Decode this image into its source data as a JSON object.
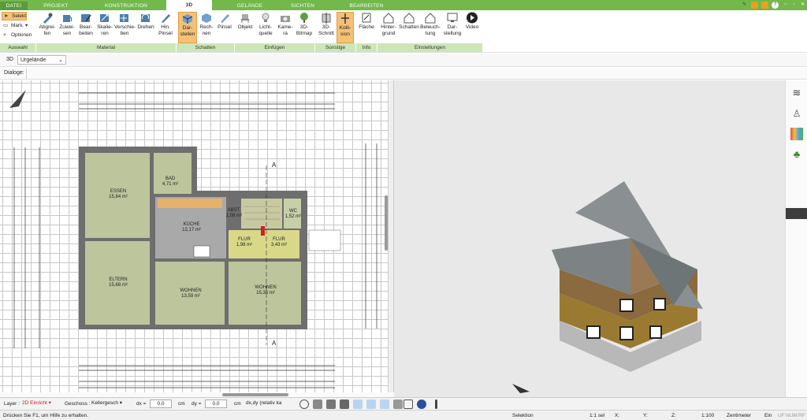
{
  "tabs": [
    "DATEI",
    "PROJEKT",
    "KONSTRUKTION",
    "3D",
    "GELÄNDE",
    "SICHTEN",
    "BEARBEITEN"
  ],
  "auswahl": {
    "select": "Selekt",
    "mark": "Mark.",
    "options": "Optionen",
    "group": "Auswahl"
  },
  "material": {
    "items": [
      "Abgrei-\nfen",
      "Zuwei-\nsen",
      "Bear-\nbeiten",
      "Skalie-\nren",
      "Verschie-\nben",
      "Drehen",
      "Hin.\nPinsel"
    ],
    "group": "Material"
  },
  "schatten": {
    "items": [
      "Dar-\nstellen",
      "Rech-\nnen",
      "Pinsel"
    ],
    "group": "Schatten"
  },
  "einfuegen": {
    "items": [
      "Objekt",
      "Licht-\nquelle",
      "Kame-\nra",
      "3D-\nBitmap"
    ],
    "group": "Einfügen"
  },
  "sonstige": {
    "items": [
      "3D-\nSchnitt",
      "Kolli-\nsion"
    ],
    "group": "Sonstige"
  },
  "info": {
    "items": [
      "Fläche"
    ],
    "group": "Info"
  },
  "einstellungen": {
    "items": [
      "Hinter-\ngrund",
      "Schatten",
      "Beleuch-\ntung",
      "Dar-\nstellung",
      "Video"
    ],
    "group": "Einstellungen"
  },
  "viewbar": {
    "mode": "3D",
    "terrain": "Urgelände"
  },
  "dialog_label": "Dialoge:",
  "rooms": [
    {
      "name": "ESSEN",
      "area": "15,84 m²"
    },
    {
      "name": "BAD",
      "area": "4,71 m²"
    },
    {
      "name": "KÜCHE",
      "area": "12,17 m²"
    },
    {
      "name": "ABST.",
      "area": "1,08 m²"
    },
    {
      "name": "WC",
      "area": "1,52 m²"
    },
    {
      "name": "FLUR",
      "area": "1,98 m²"
    },
    {
      "name": "FLUR",
      "area": "3,43 m²"
    },
    {
      "name": "ELTERN",
      "area": "15,68 m²"
    },
    {
      "name": "WOHNEN",
      "area": "13,59 m²"
    },
    {
      "name": "WOHNEN",
      "area": "15,36 m²"
    }
  ],
  "section_mark": "A",
  "toolbar": {
    "layer_label": "Layer :",
    "layer_value": "2D Einricht",
    "geschoss_label": "Geschoss :",
    "geschoss_value": "Kellergesch",
    "dx_label": "dx =",
    "dx_value": "0,0",
    "dy_label": "dy =",
    "dy_value": "0,0",
    "unit": "cm",
    "mode": "dx,dy (relativ ka"
  },
  "status": {
    "help": "Drücken Sie F1, um Hilfe zu erhalten.",
    "mode": "Selektion",
    "scale_sel": "1:1 sel",
    "x": "X:",
    "y": "Y:",
    "z": "Z:",
    "scale": "1:100",
    "unit": "Zentimeter",
    "ein": "Ein",
    "uf": "UF",
    "num": "NUM",
    "rf": "RF"
  }
}
